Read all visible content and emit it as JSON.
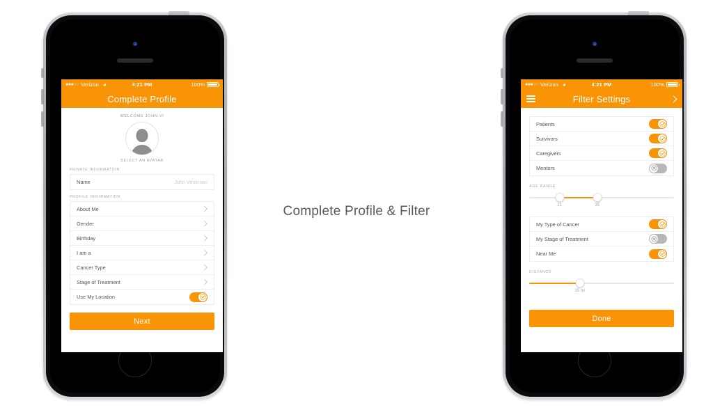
{
  "caption": "Complete Profile & Filter",
  "colors": {
    "accent": "#F89406",
    "toggle_off": "#b7b7b7",
    "text": "#555555",
    "muted": "#a8a8a8",
    "caption": "#595959"
  },
  "status_bar": {
    "signal_dots": "●●●",
    "signal_dots_hollow": "○○",
    "carrier": "Verizon",
    "wifi_icon": "wifi-icon",
    "time": "4:21 PM",
    "battery_percent": "100%",
    "battery_icon": "battery-full-icon"
  },
  "left_phone": {
    "navbar": {
      "title": "Complete Profile"
    },
    "welcome": "WELCOME JOHN.VI",
    "avatar": {
      "name": "avatar",
      "caption": "SELECT AN AVATAR"
    },
    "sections": [
      {
        "label": "PRIVATE INFORMATION",
        "rows": [
          {
            "label": "Name",
            "placeholder": "John Venkman",
            "type": "input"
          }
        ]
      },
      {
        "label": "PROFILE INFORMATION",
        "rows": [
          {
            "label": "About Me",
            "type": "chevron"
          },
          {
            "label": "Gender",
            "type": "chevron"
          },
          {
            "label": "Birthday",
            "type": "chevron"
          },
          {
            "label": "I am a",
            "type": "chevron"
          },
          {
            "label": "Cancer Type",
            "type": "chevron"
          },
          {
            "label": "Stage of Treatment",
            "type": "chevron"
          },
          {
            "label": "Use My Location",
            "type": "toggle",
            "on": true
          }
        ]
      }
    ],
    "primary_button": "Next"
  },
  "right_phone": {
    "navbar": {
      "title": "Filter Settings",
      "menu_icon": "hamburger-menu-icon",
      "forward_icon": "chevron-right-icon"
    },
    "group_one": [
      {
        "label": "Patients",
        "on": true
      },
      {
        "label": "Survivors",
        "on": true
      },
      {
        "label": "Caregivers",
        "on": true
      },
      {
        "label": "Mentors",
        "on": false
      }
    ],
    "age_range": {
      "label": "AGE RANGE",
      "min_value": "21",
      "max_value": "35",
      "min_pct": 21,
      "max_pct": 47
    },
    "group_two": [
      {
        "label": "My Type of Cancer",
        "on": true
      },
      {
        "label": "My Stage of Treatment",
        "on": false
      },
      {
        "label": "Near Me",
        "on": true
      }
    ],
    "distance": {
      "label": "DISTANCE",
      "value": "35 mi",
      "pct": 35
    },
    "primary_button": "Done"
  }
}
